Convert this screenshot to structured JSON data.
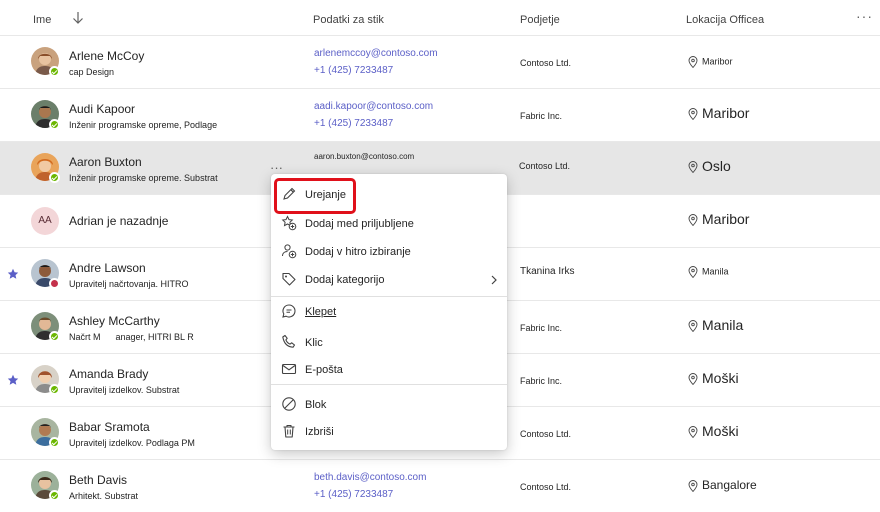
{
  "header": {
    "col_name": "Ime",
    "col_contact": "Podatki za stik",
    "col_dept": "Podjetje",
    "col_location": "Lokacija Officea",
    "more": "···"
  },
  "rows": [
    {
      "name": "Arlene McCoy",
      "title": "cap Design",
      "email": "arlenemccoy@contoso.com",
      "phone": "+1 (425) 7233487",
      "dept": "Contoso Ltd.",
      "location": "Maribor",
      "presence": "available",
      "favorite": false
    },
    {
      "name": "Audi Kapoor",
      "title": "Inženir programske opreme, Podlage",
      "email": "aadi.kapoor@contoso.com",
      "phone": "+1 (425) 7233487",
      "dept": "Fabric Inc.",
      "location": "Maribor",
      "presence": "available",
      "favorite": false
    },
    {
      "name": "Aaron Buxton",
      "title": "Inženir programske opreme. Substrat",
      "email": "aaron.buxton@contoso.com",
      "phone": "",
      "dept": "Contoso Ltd.",
      "location": "Oslo",
      "presence": "available",
      "favorite": false,
      "more": "···"
    },
    {
      "name": "Adrian je nazadnje",
      "title": "",
      "initials": "AA",
      "email": "",
      "phone": "",
      "dept": "",
      "location": "Maribor",
      "favorite": false
    },
    {
      "name": "Andre Lawson",
      "title": "Upravitelj načrtovanja. HITRO",
      "email": "",
      "phone": "",
      "dept": "Tkanina Irks",
      "location": "Manila",
      "presence": "busy",
      "favorite": true
    },
    {
      "name": "Ashley McCarthy",
      "title": "Načrt M",
      "title_b": "anager, HITRI BL R",
      "email": "",
      "phone": "",
      "dept": "Fabric Inc.",
      "location": "Manila",
      "presence": "available",
      "favorite": false
    },
    {
      "name": "Amanda Brady",
      "title": "Upravitelj izdelkov. Substrat",
      "email": "",
      "phone": "",
      "dept": "Fabric Inc.",
      "location": "Moški",
      "presence": "available",
      "favorite": true
    },
    {
      "name": "Babar Sramota",
      "title": "Upravitelj izdelkov. Podlaga PM",
      "email": "",
      "phone": "",
      "dept": "Contoso Ltd.",
      "location": "Moški",
      "presence": "available",
      "favorite": false
    },
    {
      "name": "Beth Davis",
      "title": "Arhitekt. Substrat",
      "email": "beth.davis@contoso.com",
      "phone": "+1 (425) 7233487",
      "dept": "Contoso Ltd.",
      "location": "Bangalore",
      "presence": "available",
      "favorite": false
    }
  ],
  "context_menu": {
    "items": [
      {
        "label": "Urejanje",
        "icon": "pencil-icon"
      },
      {
        "label": "Dodaj med priljubljene",
        "icon": "star-add-icon"
      },
      {
        "label": "Dodaj v hitro izbiranje",
        "icon": "speed-dial-icon"
      },
      {
        "label": "Dodaj kategorijo",
        "icon": "tag-icon"
      },
      {
        "label": "Klepet",
        "icon": "chat-icon"
      },
      {
        "label": "Klic",
        "icon": "phone-icon"
      },
      {
        "label": "E-pošta",
        "icon": "mail-icon"
      },
      {
        "label": "Blok",
        "icon": "block-icon"
      },
      {
        "label": "Izbriši",
        "icon": "delete-icon"
      }
    ]
  },
  "colors": {
    "accent_link": "#5b5fc7",
    "selected_row": "#e6e6e6",
    "highlight": "#e0101a",
    "presence_available": "#6bb700",
    "presence_busy": "#c4314b",
    "favorite_star": "#5b5fc7"
  }
}
